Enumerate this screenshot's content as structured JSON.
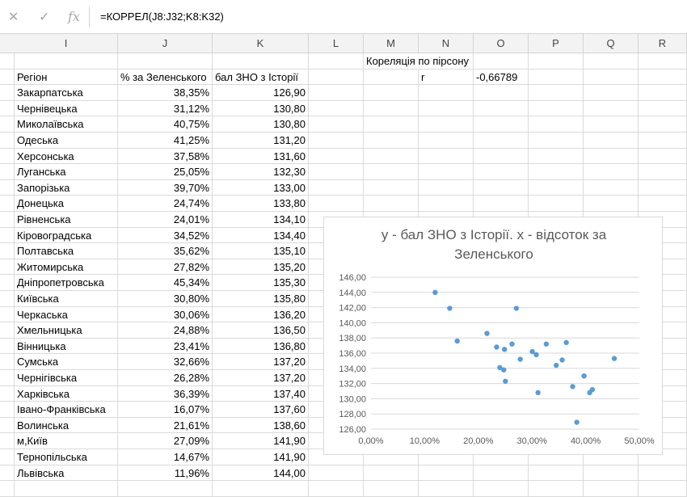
{
  "formula_bar": {
    "cancel_icon": "✕",
    "confirm_icon": "✓",
    "function_icon": "fx",
    "formula": "=КОРРЕЛ(J8:J32;K8:K32)"
  },
  "columns": [
    "I",
    "J",
    "K",
    "L",
    "M",
    "N",
    "O",
    "P",
    "Q",
    "R"
  ],
  "headers": {
    "region": "Регіон",
    "percent": "% за Зеленського",
    "score": "бал ЗНО з Історії"
  },
  "correlation": {
    "title": "Кореляція по пірсону",
    "label": "r",
    "value": "-0,66789"
  },
  "rows": [
    {
      "region": "Закарпатська",
      "percent": "38,35%",
      "score": "126,90"
    },
    {
      "region": "Чернівецька",
      "percent": "31,12%",
      "score": "130,80"
    },
    {
      "region": "Миколаївська",
      "percent": "40,75%",
      "score": "130,80"
    },
    {
      "region": "Одеська",
      "percent": "41,25%",
      "score": "131,20"
    },
    {
      "region": "Херсонська",
      "percent": "37,58%",
      "score": "131,60"
    },
    {
      "region": "Луганська",
      "percent": "25,05%",
      "score": "132,30"
    },
    {
      "region": "Запорізька",
      "percent": "39,70%",
      "score": "133,00"
    },
    {
      "region": "Донецька",
      "percent": "24,74%",
      "score": "133,80"
    },
    {
      "region": "Рівненська",
      "percent": "24,01%",
      "score": "134,10"
    },
    {
      "region": "Кіровоградська",
      "percent": "34,52%",
      "score": "134,40"
    },
    {
      "region": "Полтавська",
      "percent": "35,62%",
      "score": "135,10"
    },
    {
      "region": "Житомирська",
      "percent": "27,82%",
      "score": "135,20"
    },
    {
      "region": "Дніпропетровська",
      "percent": "45,34%",
      "score": "135,30"
    },
    {
      "region": "Київська",
      "percent": "30,80%",
      "score": "135,80"
    },
    {
      "region": "Черкаська",
      "percent": "30,06%",
      "score": "136,20"
    },
    {
      "region": "Хмельницька",
      "percent": "24,88%",
      "score": "136,50"
    },
    {
      "region": "Вінницька",
      "percent": "23,41%",
      "score": "136,80"
    },
    {
      "region": "Сумська",
      "percent": "32,66%",
      "score": "137,20"
    },
    {
      "region": "Чернігівська",
      "percent": "26,28%",
      "score": "137,20"
    },
    {
      "region": "Харківська",
      "percent": "36,39%",
      "score": "137,40"
    },
    {
      "region": "Івано-Франківська",
      "percent": "16,07%",
      "score": "137,60"
    },
    {
      "region": "Волинська",
      "percent": "21,61%",
      "score": "138,60"
    },
    {
      "region": "м,Київ",
      "percent": "27,09%",
      "score": "141,90"
    },
    {
      "region": "Тернопільська",
      "percent": "14,67%",
      "score": "141,90"
    },
    {
      "region": "Львівська",
      "percent": "11,96%",
      "score": "144,00"
    }
  ],
  "chart_data": {
    "type": "scatter",
    "title": "y - бал ЗНО з Історії. x - відсоток за Зеленського",
    "xlabel": "",
    "ylabel": "",
    "xlim": [
      0,
      0.5
    ],
    "ylim": [
      126,
      146
    ],
    "x_ticks": [
      "0,00%",
      "10,00%",
      "20,00%",
      "30,00%",
      "40,00%",
      "50,00%"
    ],
    "y_ticks": [
      "126,00",
      "128,00",
      "130,00",
      "132,00",
      "134,00",
      "136,00",
      "138,00",
      "140,00",
      "142,00",
      "144,00",
      "146,00"
    ],
    "grid": true,
    "legend": "none",
    "point_color": "#5b9bd5",
    "x": [
      0.3835,
      0.3112,
      0.4075,
      0.4125,
      0.3758,
      0.2505,
      0.397,
      0.2474,
      0.2401,
      0.3452,
      0.3562,
      0.2782,
      0.4534,
      0.308,
      0.3006,
      0.2488,
      0.2341,
      0.3266,
      0.2628,
      0.3639,
      0.1607,
      0.2161,
      0.2709,
      0.1467,
      0.1196
    ],
    "y": [
      126.9,
      130.8,
      130.8,
      131.2,
      131.6,
      132.3,
      133.0,
      133.8,
      134.1,
      134.4,
      135.1,
      135.2,
      135.3,
      135.8,
      136.2,
      136.5,
      136.8,
      137.2,
      137.2,
      137.4,
      137.6,
      138.6,
      141.9,
      141.9,
      144.0
    ]
  }
}
